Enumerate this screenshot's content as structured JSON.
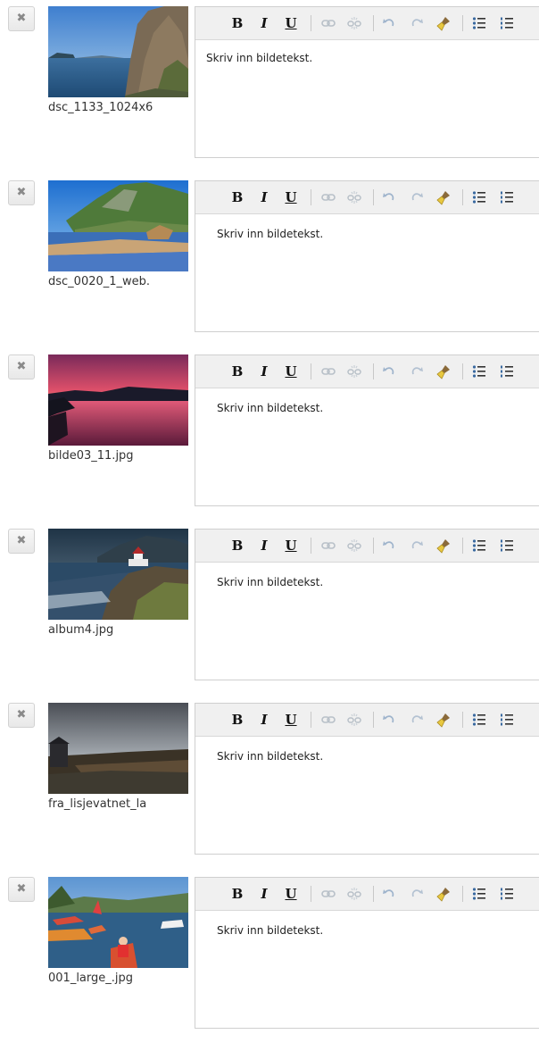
{
  "remove_glyph": "✖",
  "toolbar": {
    "bold": "B",
    "italic": "I",
    "underline": "U"
  },
  "items": [
    {
      "filename": "dsc_1133_1024x6",
      "caption": "Skriv inn bildetekst."
    },
    {
      "filename": "dsc_0020_1_web.",
      "caption": "Skriv inn bildetekst."
    },
    {
      "filename": "bilde03_11.jpg",
      "caption": "Skriv inn bildetekst."
    },
    {
      "filename": "album4.jpg",
      "caption": "Skriv inn bildetekst."
    },
    {
      "filename": "fra_lisjevatnet_la",
      "caption": "Skriv inn bildetekst."
    },
    {
      "filename": "001_large_.jpg",
      "caption": "Skriv inn bildetekst."
    }
  ],
  "icons": [
    "bold-icon",
    "italic-icon",
    "underline-icon",
    "link-icon",
    "unlink-icon",
    "undo-icon",
    "redo-icon",
    "clean-format-icon",
    "bullet-list-icon",
    "numbered-list-icon"
  ]
}
